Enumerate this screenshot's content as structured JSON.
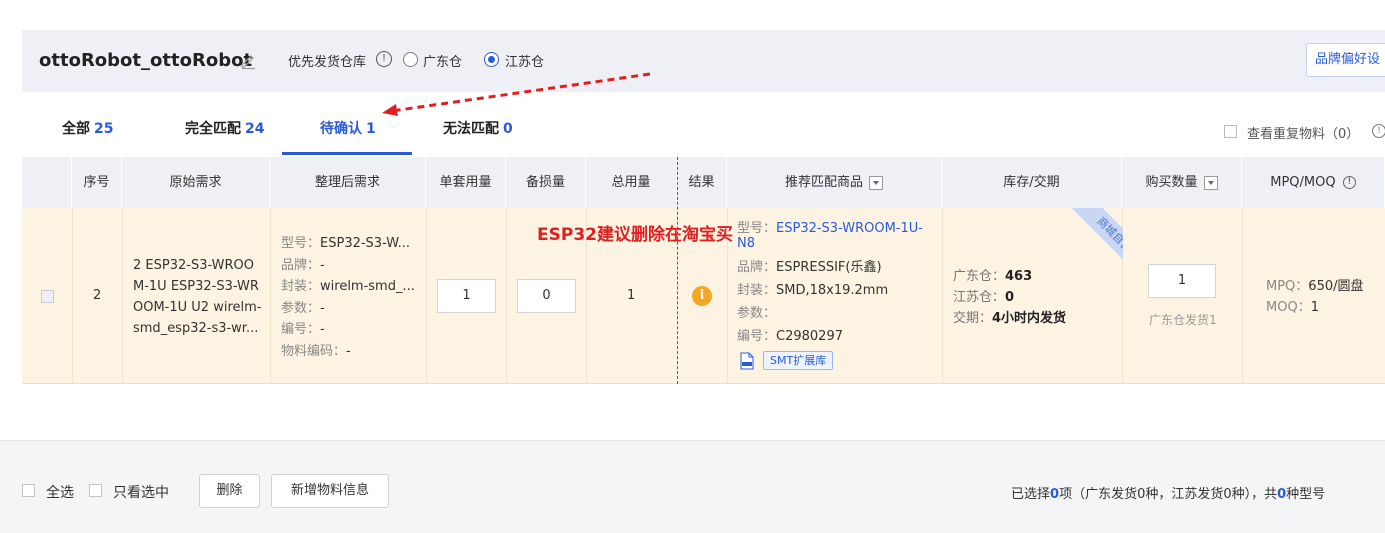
{
  "header": {
    "project_title": "ottoRobot_ottoRobot",
    "warehouse_label": "优先发货仓库",
    "info_glyph": "!",
    "options": [
      {
        "label": "广东仓",
        "selected": false
      },
      {
        "label": "江苏仓",
        "selected": true
      }
    ],
    "brand_pref_button": "品牌偏好设"
  },
  "tabs": [
    {
      "label": "全部",
      "count": "25",
      "active": false
    },
    {
      "label": "完全匹配",
      "count": "24",
      "active": false
    },
    {
      "label": "待确认",
      "count": "1",
      "active": true
    },
    {
      "label": "无法匹配",
      "count": "0",
      "active": false
    }
  ],
  "duplicate_toggle": {
    "label": "查看重复物料（0）"
  },
  "table": {
    "headers": {
      "index": "序号",
      "original": "原始需求",
      "cleaned": "整理后需求",
      "unit_qty": "单套用量",
      "spare_qty": "备损量",
      "total_qty": "总用量",
      "result": "结果",
      "recommend": "推荐匹配商品",
      "stock": "库存/交期",
      "buy_qty": "购买数量",
      "mpq": "MPQ/MOQ"
    },
    "row": {
      "index": "2",
      "original": "2 ESP32-S3-WROOM-1U ESP32-S3-WROOM-1U U2 wirelm-smd_esp32-s3-wr...",
      "cleaned": {
        "model_k": "型号：",
        "model_v": "ESP32-S3-W...",
        "brand_k": "品牌：",
        "brand_v": "-",
        "package_k": "封装：",
        "package_v": "wirelm-smd_...",
        "param_k": "参数：",
        "param_v": "-",
        "code_k": "编号：",
        "code_v": "-",
        "material_k": "物料编码：",
        "material_v": "-"
      },
      "unit_qty": "1",
      "spare_qty": "0",
      "total_qty": "1",
      "result_icon": "i",
      "recommend": {
        "model_k": "型号：",
        "model_v": "ESP32-S3-WROOM-1U-N8",
        "brand_k": "品牌：",
        "brand_v": "ESPRESSIF(乐鑫)",
        "package_k": "封装：",
        "package_v": "SMD,18x19.2mm",
        "param_k": "参数：",
        "param_v": "",
        "code_k": "编号：",
        "code_v": "C2980297",
        "smt_tag": "SMT扩展库",
        "ribbon": "商城自营"
      },
      "stock": {
        "gd_k": "广东仓：",
        "gd_v": "463",
        "js_k": "江苏仓：",
        "js_v": "0",
        "lead_k": "交期：",
        "lead_v": "4小时内发货"
      },
      "buy_qty": "1",
      "buy_sub": "广东仓发货1",
      "mpq": {
        "mpq_k": "MPQ：",
        "mpq_v": "650/圆盘",
        "moq_k": "MOQ：",
        "moq_v": "1"
      }
    }
  },
  "annotation": "ESP32建议删除在淘宝买",
  "footer": {
    "select_all": "全选",
    "only_selected": "只看选中",
    "delete_button": "删除",
    "add_button": "新增物料信息",
    "summary_prefix": "已选择",
    "summary_count": "0",
    "summary_mid": "项（广东发货0种，江苏发货0种），共",
    "summary_models": "0",
    "summary_suffix": "种型号"
  },
  "colors": {
    "accent": "#2a5bd7",
    "row_bg": "#fdf3e3",
    "annotation": "#e02020",
    "warning": "#f5a623"
  }
}
